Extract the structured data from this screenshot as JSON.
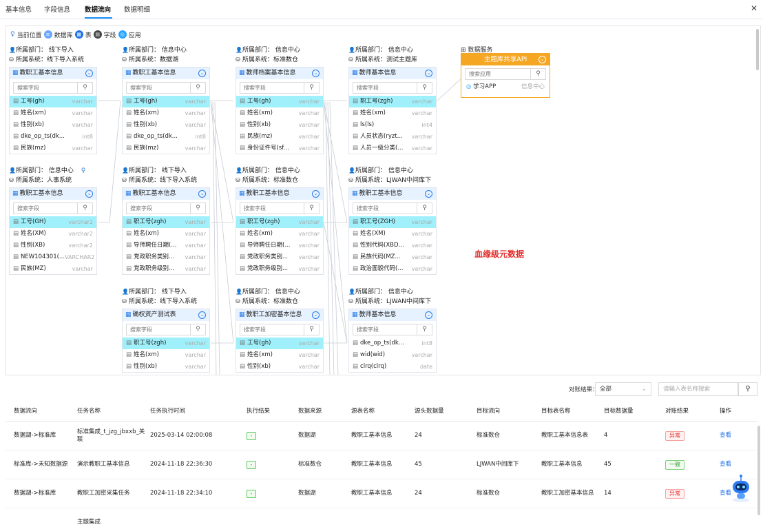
{
  "tabs": [
    "基本信息",
    "字段信息",
    "数据流向",
    "数据明细"
  ],
  "active_tab": 2,
  "legend": {
    "current": "当前位置",
    "db": "数据库",
    "table": "表",
    "field": "字段",
    "app": "应用"
  },
  "groups": [
    {
      "dept": "线下导入",
      "system": "线下导入系统",
      "table": "教职工基本信息",
      "search": "搜索字段",
      "fields": [
        [
          "工号(gh)",
          "varchar"
        ],
        [
          "姓名(xm)",
          "varchar"
        ],
        [
          "性别(xb)",
          "varchar"
        ],
        [
          "dke_op_ts(dk...",
          "int8"
        ],
        [
          "民族(mz)",
          "varchar"
        ]
      ],
      "hl": 0
    },
    {
      "dept": "信息中心",
      "system": "数据湖",
      "table": "教职工基本信息",
      "search": "搜索字段",
      "fields": [
        [
          "工号(gh)",
          "varchar"
        ],
        [
          "姓名(xm)",
          "varchar"
        ],
        [
          "性别(xb)",
          "varchar"
        ],
        [
          "dke_op_ts(dk...",
          "int8"
        ],
        [
          "民族(mz)",
          "varchar"
        ]
      ],
      "hl": 0
    },
    {
      "dept": "信息中心",
      "system": "标准数仓",
      "table": "教师档案基本信息",
      "search": "搜索字段",
      "fields": [
        [
          "工号(gh)",
          "varchar"
        ],
        [
          "姓名(xm)",
          "varchar"
        ],
        [
          "性别(xb)",
          "varchar"
        ],
        [
          "民族(mz)",
          "varchar"
        ],
        [
          "身份证件号(sf...",
          "varchar"
        ]
      ],
      "hl": 0
    },
    {
      "dept": "信息中心",
      "system": "测试主题库",
      "table": "教师基本信息",
      "search": "搜索字段",
      "fields": [
        [
          "职工号(zgh)",
          "varchar"
        ],
        [
          "姓名(xm)",
          "varchar"
        ],
        [
          "ls(ls)",
          "int4"
        ],
        [
          "人员状态(ryzt...",
          "varchar"
        ],
        [
          "人员一级分类(...",
          "varchar"
        ]
      ],
      "hl": 0
    },
    {
      "dept": "信息中心",
      "system": "人事系统",
      "table": "教职工基本信息",
      "search": "搜索字段",
      "fields": [
        [
          "工号(GH)",
          "varchar2"
        ],
        [
          "姓名(XM)",
          "varchar2"
        ],
        [
          "性别(XB)",
          "varchar2"
        ],
        [
          "NEW104301(...",
          "VARCHAR2"
        ],
        [
          "民族(MZ)",
          "varchar"
        ]
      ],
      "hl": 0
    },
    {
      "dept": "线下导入",
      "system": "线下导入系统",
      "table": "教职工基本信息",
      "search": "搜索字段",
      "fields": [
        [
          "职工号(zgh)",
          "varchar"
        ],
        [
          "姓名(xm)",
          "varchar"
        ],
        [
          "导师聘任日期(...",
          "varchar"
        ],
        [
          "党政职务类别...",
          "varchar"
        ],
        [
          "党政职务级别...",
          "varchar"
        ]
      ],
      "hl": 0
    },
    {
      "dept": "信息中心",
      "system": "标准数仓",
      "table": "教职工基本信息",
      "search": "搜索字段",
      "fields": [
        [
          "职工号(zgh)",
          "varchar"
        ],
        [
          "姓名(xm)",
          "varchar"
        ],
        [
          "导师聘任日期(...",
          "varchar"
        ],
        [
          "党政职务类别...",
          "varchar"
        ],
        [
          "党政职务级别...",
          "varchar"
        ]
      ],
      "hl": 0
    },
    {
      "dept": "信息中心",
      "system": "LJWAN中间库下",
      "table": "教职工基本信息",
      "search": "搜索字段",
      "fields": [
        [
          "职工号(ZGH)",
          "varchar"
        ],
        [
          "姓名(XM)",
          "varchar"
        ],
        [
          "性别代码(XBD...",
          "varchar"
        ],
        [
          "民族代码(MZ...",
          "varchar"
        ],
        [
          "政治面貌代码(...",
          "varchar"
        ]
      ],
      "hl": 0
    },
    {
      "dept": "线下导入",
      "system": "线下导入系统",
      "table": "确权资产测试表",
      "search": "搜索字段",
      "fields": [
        [
          "职工号(zgh)",
          "varchar"
        ],
        [
          "姓名(xm)",
          "varchar"
        ],
        [
          "性别(xb)",
          "varchar"
        ]
      ],
      "hl": 0
    },
    {
      "dept": "信息中心",
      "system": "标准数仓",
      "table": "教职工加密基本信息",
      "search": "搜索字段",
      "fields": [
        [
          "工号(gh)",
          "varchar"
        ],
        [
          "姓名(xm)",
          "varchar"
        ],
        [
          "性别(xb)",
          "varchar"
        ]
      ],
      "hl": 0
    },
    {
      "dept": "信息中心",
      "system": "LJWAN中间库下",
      "table": "教师基本信息",
      "search": "搜索字段",
      "fields": [
        [
          "dke_op_ts(dk...",
          "int8"
        ],
        [
          "wid(wid)",
          "varchar"
        ],
        [
          "clrq(clrq)",
          "date"
        ]
      ],
      "hl": -1
    }
  ],
  "dept_prefix": "所属部门：",
  "system_prefix": "所属系统：",
  "api": {
    "section": "数据服务",
    "title": "主题库共享API",
    "search": "搜索应用",
    "app": "学习APP",
    "app_dept": "信息中心"
  },
  "lineage_label": "血缘级元数据",
  "filter": {
    "label": "对账结果：",
    "value": "全部",
    "search_placeholder": "请输入表名称搜索"
  },
  "table": {
    "headers": [
      "数据流向",
      "任务名称",
      "任务执行时间",
      "执行结果",
      "数据来源",
      "源表名称",
      "源头数据量",
      "目标流向",
      "目标表名称",
      "目标数据量",
      "对账结果",
      "操作"
    ],
    "rows": [
      [
        "数据湖->标准库",
        "标准集成_t_jzg_jbxxb_关联",
        "2025-03-14 02:00:08",
        "-",
        "数据湖",
        "教职工基本信息",
        "24",
        "标准数仓",
        "教职工基本信息表",
        "4",
        "异常",
        "查看"
      ],
      [
        "标准库->未知数据源",
        "演示教职工基本信息",
        "2024-11-18 22:36:30",
        "-",
        "标准数仓",
        "教职工基本信息",
        "45",
        "LJWAN中间库下",
        "教职工基本信息",
        "45",
        "一致",
        "查看"
      ],
      [
        "数据湖->标准库",
        "教职工加密采集任务",
        "2024-11-18 22:34:10",
        "-",
        "数据湖",
        "教职工基本信息",
        "24",
        "标准数仓",
        "教职工加密基本信息",
        "14",
        "异常",
        "查看"
      ],
      [
        "",
        "主题集成",
        "",
        "",
        "",
        "",
        "",
        "",
        "",
        "",
        "",
        ""
      ]
    ]
  },
  "colors": {
    "accent": "#1f6fe6",
    "api": "#f5a623",
    "highlight": "#9ff0fb",
    "lineage": "#e0302e"
  }
}
